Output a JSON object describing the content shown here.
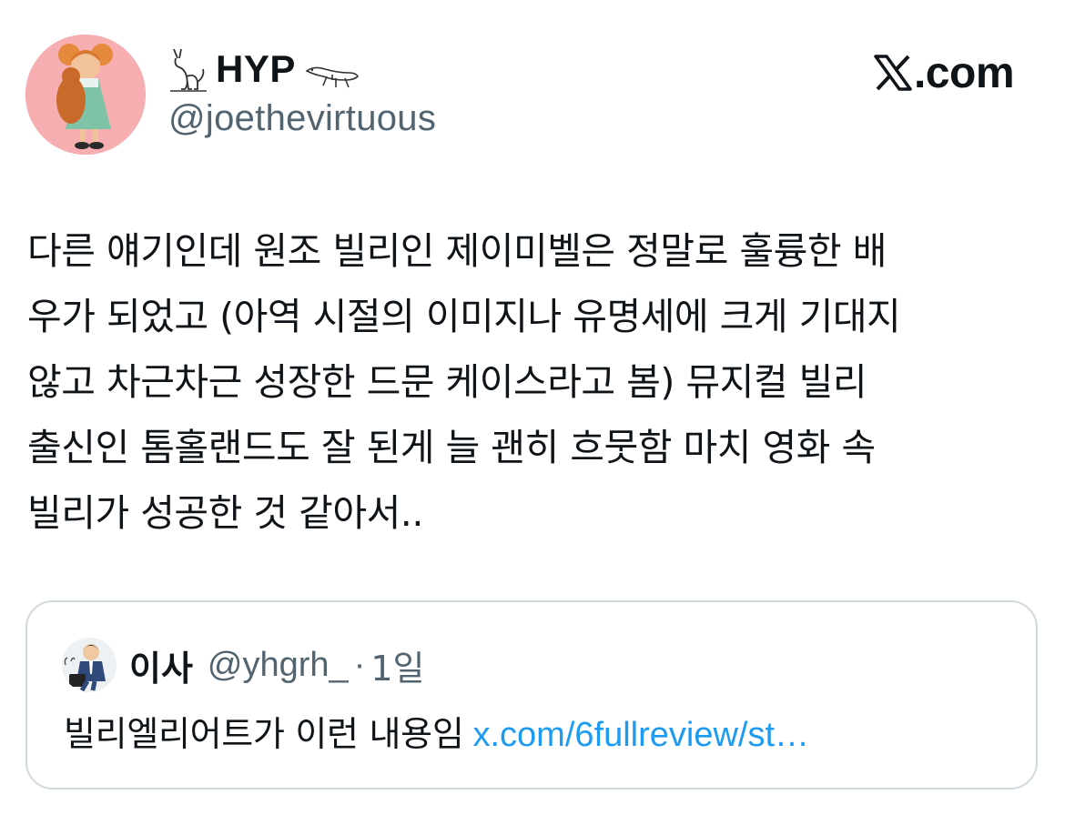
{
  "header": {
    "display_name": "HYP",
    "handle": "@joethevirtuous",
    "brand": "X.com",
    "brand_suffix": ".com",
    "avatar_icon": "profile-avatar",
    "name_emoji_left": "cat-emoji",
    "name_emoji_right": "lizard-emoji"
  },
  "tweet": {
    "text": "다른 얘기인데 원조 빌리인 제이미벨은 정말로 훌륭한 배\n우가 되었고 (아역 시절의 이미지나 유명세에 크게 기대지\n않고 차근차근 성장한 드문 케이스라고 봄) 뮤지컬 빌리\n출신인 톰홀랜드도 잘 된게 늘 괜히 흐뭇함 마치 영화 속\n빌리가 성공한 것 같아서.."
  },
  "quote": {
    "name": "이사",
    "handle": "@yhgrh_",
    "separator": "·",
    "time": "1일",
    "body": "빌리엘리어트가 이런 내용임",
    "link": "x.com/6fullreview/st…"
  },
  "colors": {
    "text": "#0f1419",
    "secondary": "#536471",
    "link": "#1d9bf0",
    "border": "#cfd9de",
    "avatar_bg": "#f4a1a5"
  }
}
